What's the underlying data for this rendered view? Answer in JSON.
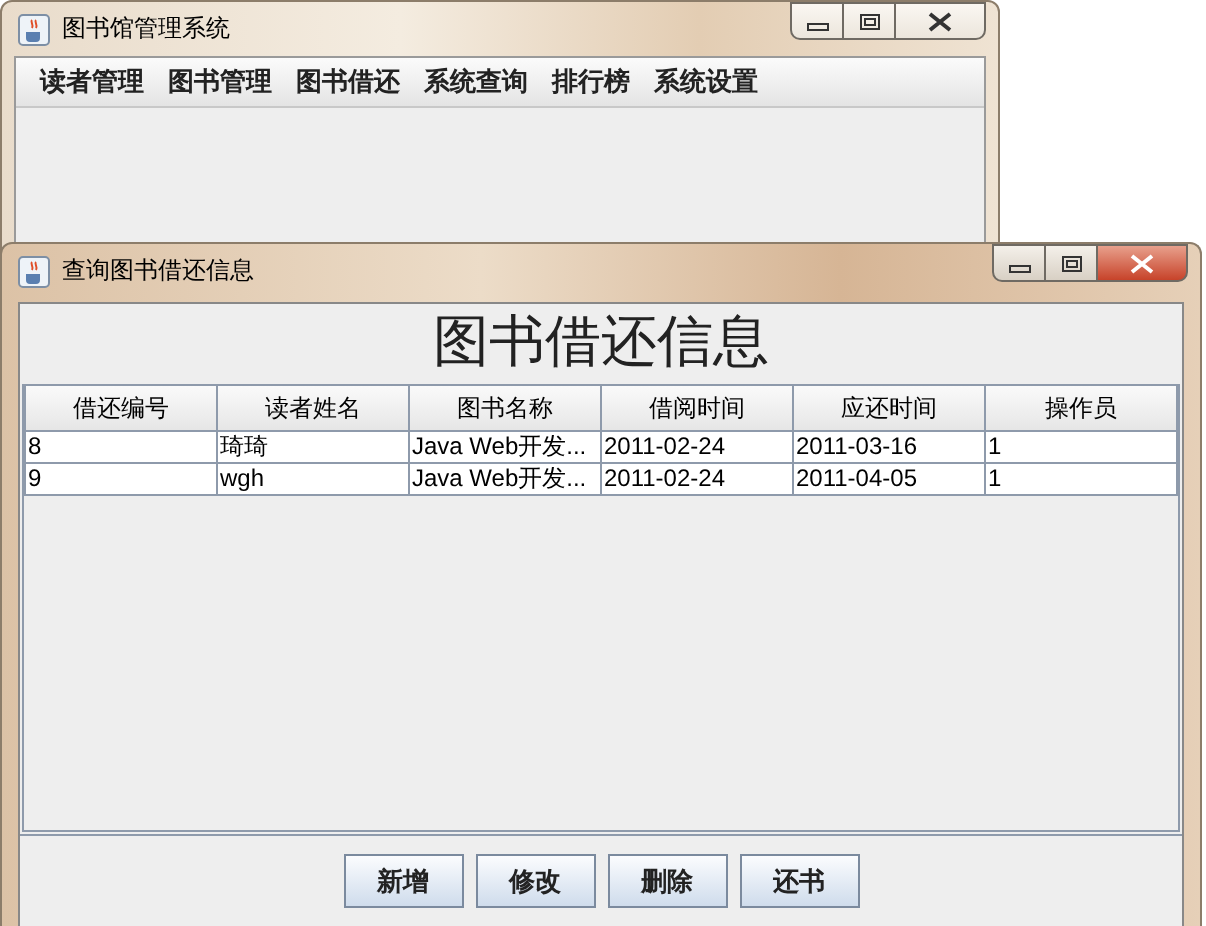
{
  "main_window": {
    "title": "图书馆管理系统",
    "menu": [
      "读者管理",
      "图书管理",
      "图书借还",
      "系统查询",
      "排行榜",
      "系统设置"
    ]
  },
  "dialog": {
    "title": "查询图书借还信息",
    "heading": "图书借还信息",
    "table": {
      "columns": [
        "借还编号",
        "读者姓名",
        "图书名称",
        "借阅时间",
        "应还时间",
        "操作员"
      ],
      "rows": [
        [
          "8",
          "琦琦",
          "Java Web开发...",
          "2011-02-24",
          "2011-03-16",
          "1"
        ],
        [
          "9",
          "wgh",
          "Java Web开发...",
          "2011-02-24",
          "2011-04-05",
          "1"
        ]
      ]
    },
    "buttons": [
      "新增",
      "修改",
      "删除",
      "还书"
    ]
  }
}
